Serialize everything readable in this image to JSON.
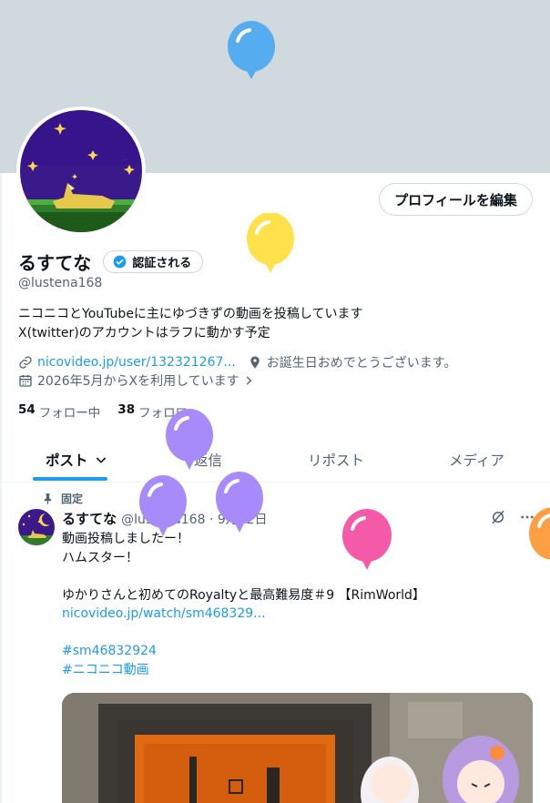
{
  "profile": {
    "display_name": "るすてな",
    "verify_label": "認証される",
    "handle": "@lustena168",
    "bio_lines": [
      "ニコニコとYouTubeに主にゆづきずの動画を投稿しています",
      "X(twitter)のアカウントはラフに動かす予定"
    ],
    "link_text": "nicovideo.jp/user/132321267...",
    "location_text": "お誕生日おめでとうございます。",
    "joined_text": "2026年5月からXを利用しています",
    "following_count": "54",
    "following_label": "フォロー中",
    "followers_count": "38",
    "followers_label": "フォロワー",
    "edit_button_label": "プロフィールを編集"
  },
  "tabs": [
    {
      "label": "ポスト"
    },
    {
      "label": "返信"
    },
    {
      "label": "リポスト"
    },
    {
      "label": "メディア"
    }
  ],
  "post": {
    "pinned_label": "固定",
    "author_name": "るすてな",
    "author_handle_date": "@lustena168 · 9月22日",
    "lines": [
      "動画投稿しましたー！",
      "ハムスター！",
      "",
      "ゆかりさんと初めてのRoyaltyと最高難易度＃9 【RimWorld】",
      "nicovideo.jp/watch/sm468329...",
      "",
      "#sm46832924",
      "#ニコニコ動画"
    ]
  },
  "icons": {
    "link": "link-icon",
    "location": "location-pin-icon",
    "calendar": "calendar-icon",
    "verified": "verified-check-icon",
    "pin": "pin-icon",
    "grok": "grok-icon",
    "more": "more-icon",
    "chevron": "chevron-down-icon"
  },
  "colors": {
    "accent": "#1d9bf0",
    "banner": "#cfd9de",
    "balloon_blue": "#55acee",
    "balloon_yellow": "#ffe14b",
    "balloon_purple": "#a78bfa",
    "balloon_pink": "#f55aa8",
    "balloon_orange": "#ff9f43"
  }
}
